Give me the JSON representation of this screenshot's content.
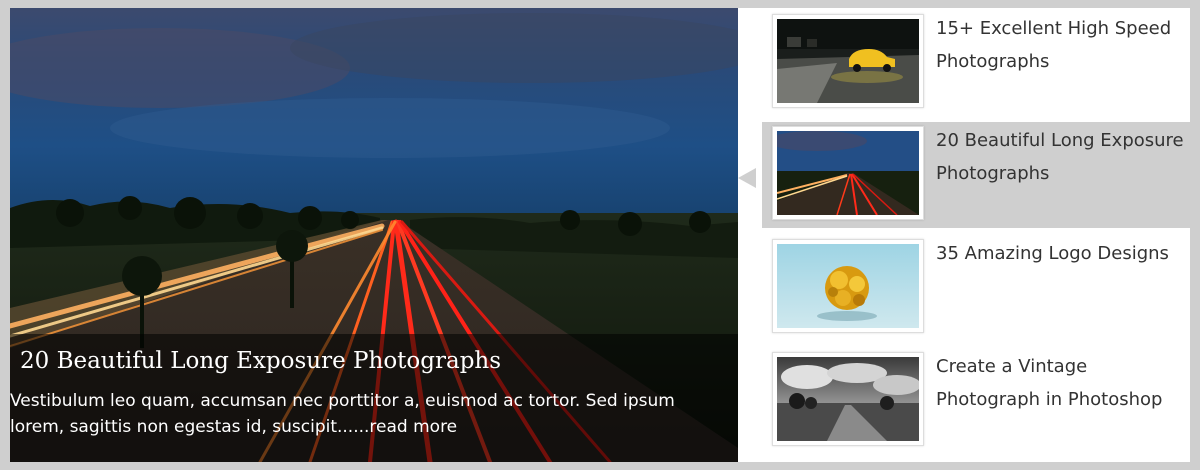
{
  "featured": {
    "title": "20 Beautiful Long Exposure Photographs",
    "excerpt": "Vestibulum leo quam, accumsan nec porttitor a, euismod ac tortor. Sed ipsum lorem, sagittis non egestas id, suscipit......",
    "read_more": "read more",
    "image": "long-exposure-highway-night"
  },
  "thumbnails": [
    {
      "title": "15+ Excellent High Speed Photographs",
      "image": "yellow-car-wet-road",
      "active": false
    },
    {
      "title": "20 Beautiful Long Exposure Photographs",
      "image": "long-exposure-highway-night",
      "active": true
    },
    {
      "title": "35 Amazing Logo Designs",
      "image": "yellow-knot-sculpture",
      "active": false
    },
    {
      "title": "Create a Vintage Photograph in Photoshop",
      "image": "black-white-landscape-road",
      "active": false
    }
  ],
  "colors": {
    "frame": "#cfcfcf",
    "panel": "#ffffff",
    "active_item": "#cfcfcf",
    "thumb_title": "#333333"
  }
}
